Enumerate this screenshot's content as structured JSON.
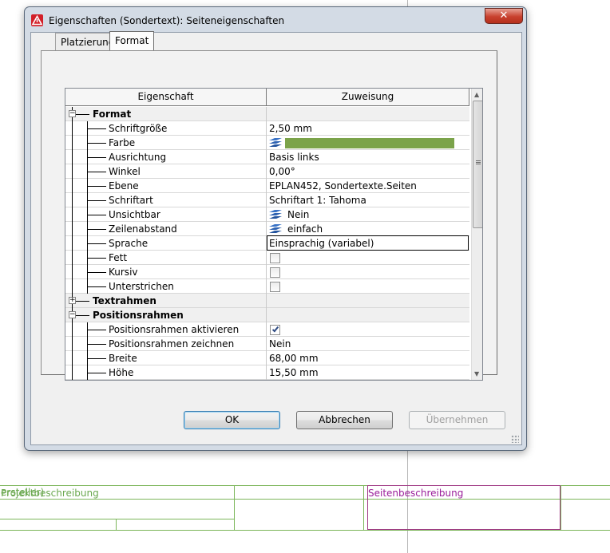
{
  "window": {
    "title": "Eigenschaften (Sondertext): Seiteneigenschaften",
    "close_glyph": "✕",
    "icon": "eplan-app-icon"
  },
  "tabs": [
    {
      "label": "Platzierung",
      "active": false
    },
    {
      "label": "Format",
      "active": true
    }
  ],
  "grid": {
    "headers": [
      "Eigenschaft",
      "Zuweisung"
    ],
    "rows": [
      {
        "name": "Format",
        "kind": "group",
        "expanded": true,
        "value": ""
      },
      {
        "name": "Schriftgröße",
        "kind": "prop",
        "value": "2,50 mm"
      },
      {
        "name": "Farbe",
        "kind": "prop",
        "value": "",
        "layer_icon": true,
        "color_swatch": "#7ba34a"
      },
      {
        "name": "Ausrichtung",
        "kind": "prop",
        "value": "Basis links"
      },
      {
        "name": "Winkel",
        "kind": "prop",
        "value": "0,00°"
      },
      {
        "name": "Ebene",
        "kind": "prop",
        "value": "EPLAN452, Sondertexte.Seiten"
      },
      {
        "name": "Schriftart",
        "kind": "prop",
        "value": "Schriftart 1: Tahoma"
      },
      {
        "name": "Unsichtbar",
        "kind": "prop",
        "value": "Nein",
        "layer_icon": true
      },
      {
        "name": "Zeilenabstand",
        "kind": "prop",
        "value": "einfach",
        "layer_icon": true
      },
      {
        "name": "Sprache",
        "kind": "prop",
        "value": "Einsprachig (variabel)",
        "editing": true
      },
      {
        "name": "Fett",
        "kind": "prop",
        "checkbox": false
      },
      {
        "name": "Kursiv",
        "kind": "prop",
        "checkbox": false
      },
      {
        "name": "Unterstrichen",
        "kind": "prop",
        "checkbox": false
      },
      {
        "name": "Textrahmen",
        "kind": "group",
        "expanded": false,
        "value": ""
      },
      {
        "name": "Positionsrahmen",
        "kind": "group",
        "expanded": true,
        "value": ""
      },
      {
        "name": "Positionsrahmen aktivieren",
        "kind": "prop",
        "checkbox": true
      },
      {
        "name": "Positionsrahmen zeichnen",
        "kind": "prop",
        "value": "Nein"
      },
      {
        "name": "Breite",
        "kind": "prop",
        "value": "68,00 mm"
      },
      {
        "name": "Höhe",
        "kind": "prop",
        "value": "15,50 mm"
      }
    ]
  },
  "buttons": {
    "ok": "OK",
    "cancel": "Abbrechen",
    "apply": "Übernehmen"
  },
  "background": {
    "left_label_overlap": "ersteller)",
    "left_label": "Projektbeschreibung",
    "right_label": "Seitenbeschreibung"
  },
  "colors": {
    "drawing_green": "#7cb65a",
    "drawing_purple": "#9a1d9a",
    "color_swatch": "#7ba34a"
  }
}
